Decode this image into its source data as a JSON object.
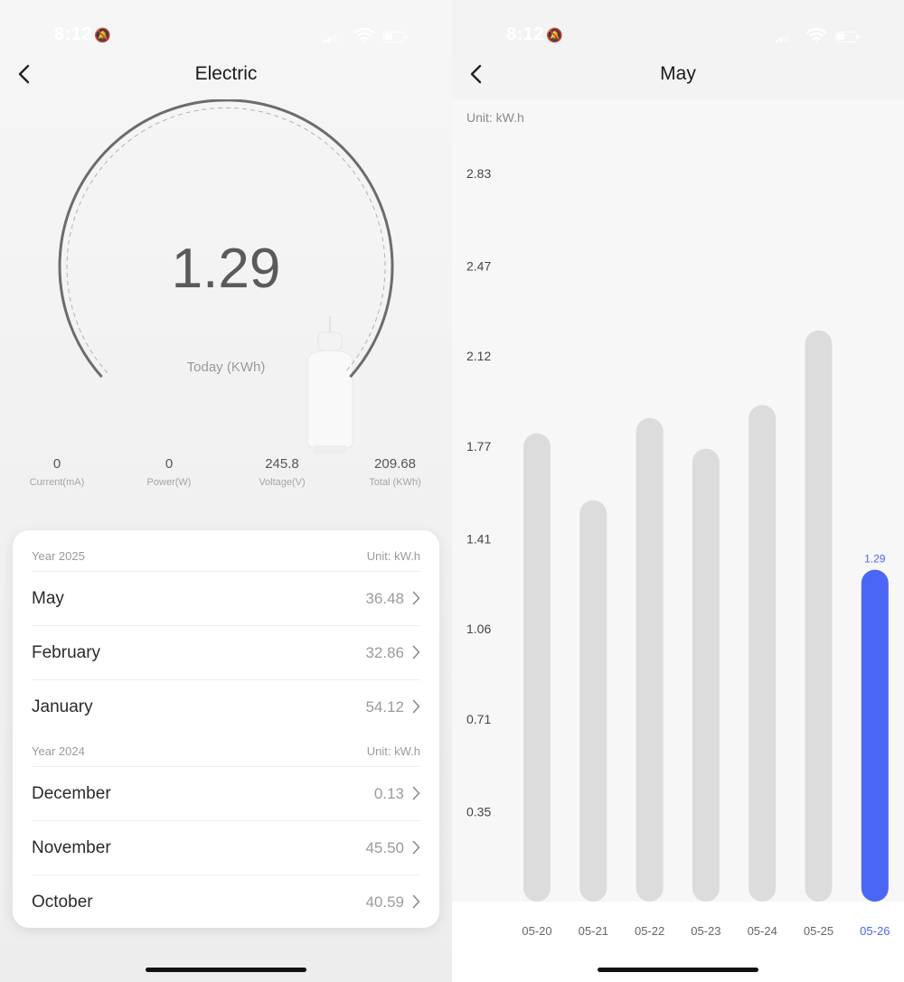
{
  "status_bar": {
    "time": "8:12"
  },
  "electric": {
    "title": "Electric",
    "today_value": "1.29",
    "today_label": "Today (KWh)",
    "stats": [
      {
        "value": "0",
        "label": "Current(mA)"
      },
      {
        "value": "0",
        "label": "Power(W)"
      },
      {
        "value": "245.8",
        "label": "Voltage(V)"
      },
      {
        "value": "209.68",
        "label": "Total (KWh)"
      }
    ],
    "history": [
      {
        "year": "Year 2025",
        "unit": "Unit: kW.h",
        "months": [
          {
            "name": "May",
            "value": "36.48"
          },
          {
            "name": "February",
            "value": "32.86"
          },
          {
            "name": "January",
            "value": "54.12"
          }
        ]
      },
      {
        "year": "Year 2024",
        "unit": "Unit: kW.h",
        "months": [
          {
            "name": "December",
            "value": "0.13"
          },
          {
            "name": "November",
            "value": "45.50"
          },
          {
            "name": "October",
            "value": "40.59"
          }
        ]
      }
    ]
  },
  "may_view": {
    "title": "May"
  },
  "chart_data": {
    "type": "bar",
    "unit_label": "Unit: kW.h",
    "categories": [
      "05-20",
      "05-21",
      "05-22",
      "05-23",
      "05-24",
      "05-25",
      "05-26"
    ],
    "values": [
      1.82,
      1.56,
      1.88,
      1.76,
      1.93,
      2.22,
      1.29
    ],
    "y_ticks": [
      "0.35",
      "0.71",
      "1.06",
      "1.41",
      "1.77",
      "2.12",
      "2.47",
      "2.83"
    ],
    "ylim": [
      0,
      2.83
    ],
    "grid": true,
    "selected_category": "05-26",
    "selected_label": "1.29",
    "colors": {
      "bar": "#dcdcdc",
      "selected": "#4a66f5",
      "grid": "#d6d6d6",
      "tick": "#444444"
    }
  }
}
